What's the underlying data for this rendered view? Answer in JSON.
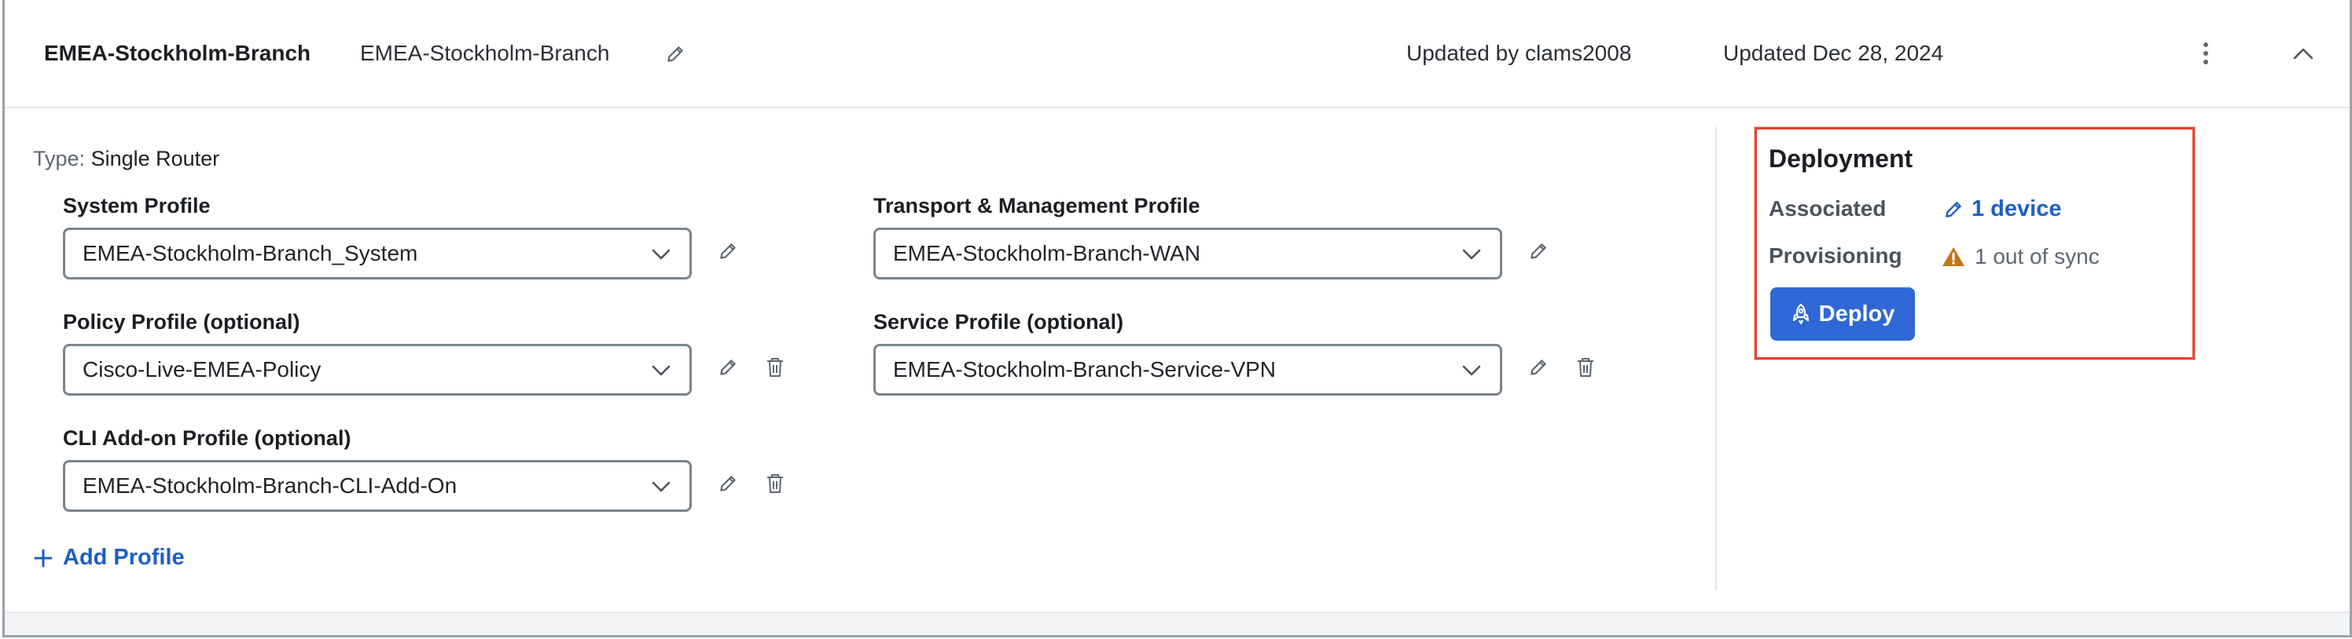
{
  "header": {
    "name": "EMEA-Stockholm-Branch",
    "description": "EMEA-Stockholm-Branch",
    "updated_by": "Updated by clams2008",
    "updated_on": "Updated Dec 28, 2024"
  },
  "config": {
    "type_label": "Type:",
    "type_value": "Single Router",
    "system_profile": {
      "label": "System Profile",
      "value": "EMEA-Stockholm-Branch_System"
    },
    "transport_profile": {
      "label": "Transport & Management Profile",
      "value": "EMEA-Stockholm-Branch-WAN"
    },
    "policy_profile": {
      "label": "Policy Profile (optional)",
      "value": "Cisco-Live-EMEA-Policy"
    },
    "service_profile": {
      "label": "Service Profile (optional)",
      "value": "EMEA-Stockholm-Branch-Service-VPN"
    },
    "cli_profile": {
      "label": "CLI Add-on Profile (optional)",
      "value": "EMEA-Stockholm-Branch-CLI-Add-On"
    },
    "add_profile_label": "Add Profile"
  },
  "deployment": {
    "title": "Deployment",
    "associated_label": "Associated",
    "associated_value": "1 device",
    "provisioning_label": "Provisioning",
    "provisioning_value": "1 out of sync",
    "deploy_button": "Deploy"
  },
  "colors": {
    "accent": "#2f68d6",
    "link": "#1d5fc4",
    "warning": "#c27417",
    "highlight_box": "#e5442f"
  },
  "icons": {
    "edit": "pencil-icon",
    "delete": "trash-icon",
    "more": "kebab-menu-icon",
    "collapse": "chevron-up-icon",
    "dropdown": "chevron-down-icon",
    "link": "link-edit-icon",
    "warning": "warning-triangle-icon",
    "deploy": "rocket-icon",
    "add": "plus-icon"
  }
}
